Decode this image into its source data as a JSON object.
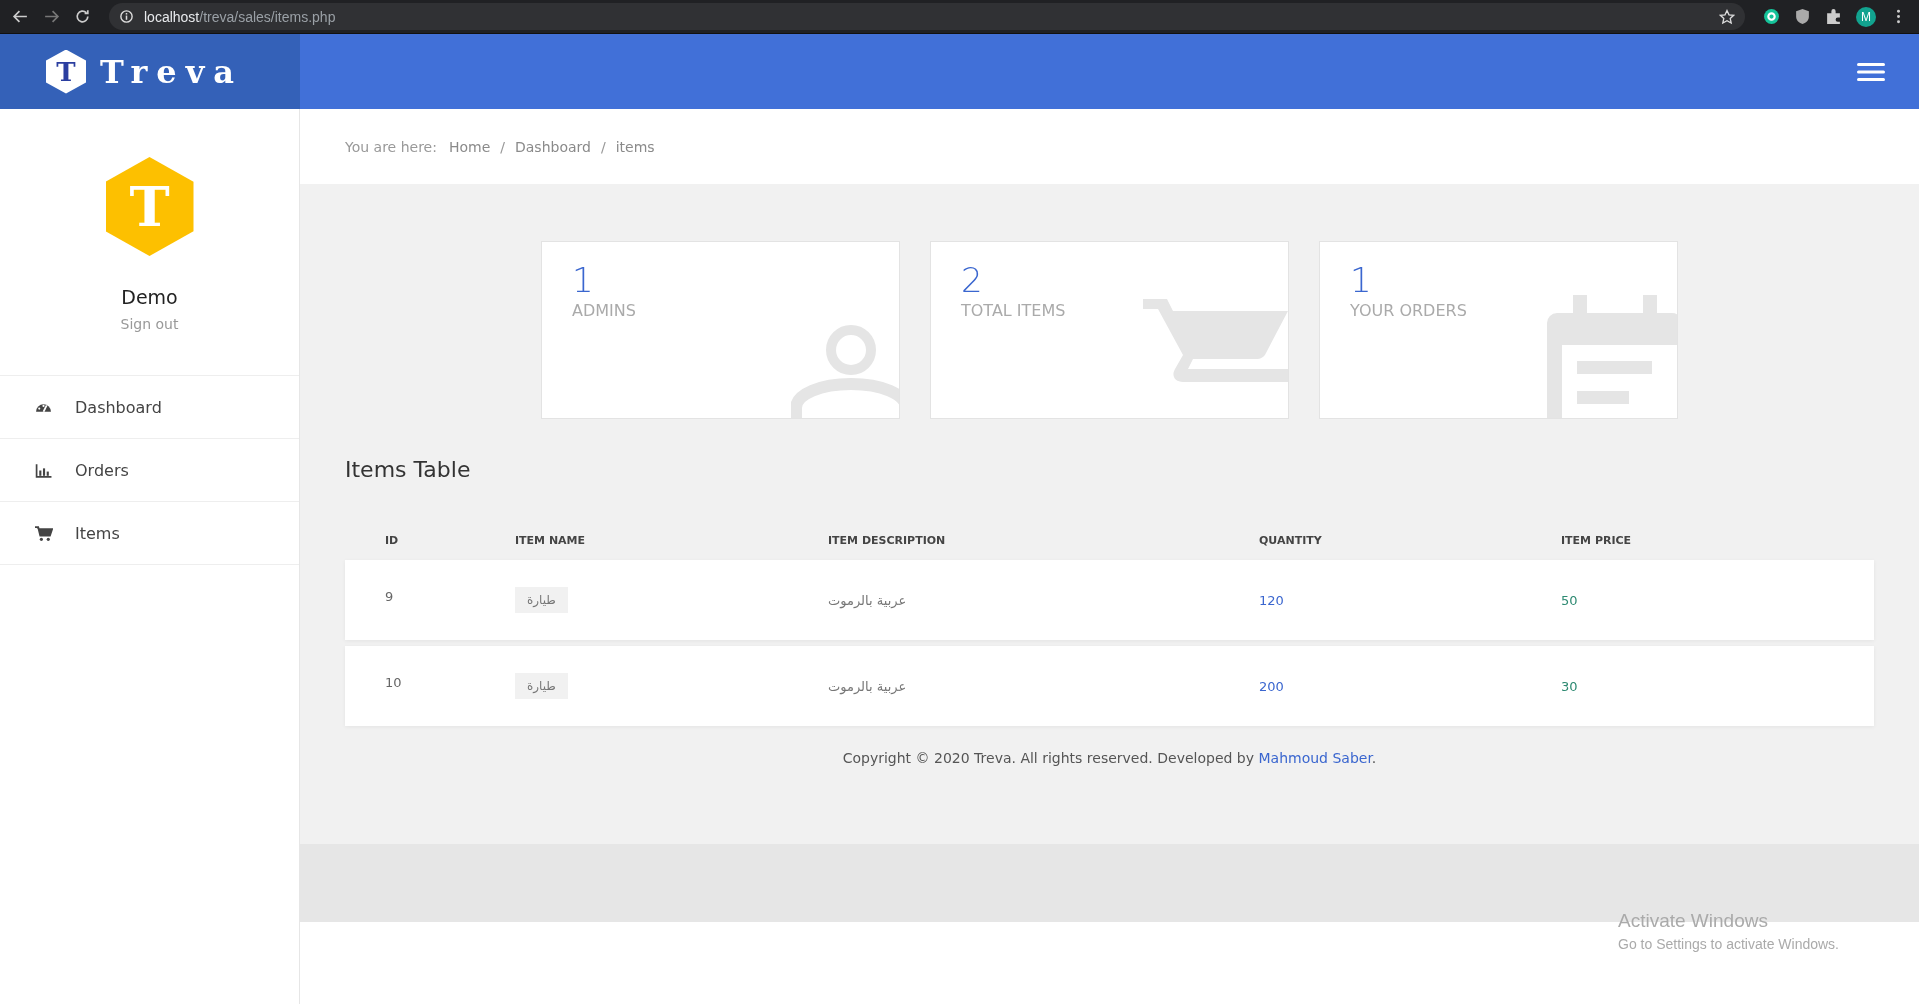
{
  "browser": {
    "url_host": "localhost",
    "url_path": "/treva/sales/items.php",
    "profile_initial": "M"
  },
  "brand": {
    "name": "Treva",
    "logo_letter": "T"
  },
  "user": {
    "avatar_letter": "T",
    "name": "Demo",
    "sign_out": "Sign out"
  },
  "sidebar": {
    "items": [
      {
        "label": "Dashboard",
        "kind": "dashboard"
      },
      {
        "label": "Orders",
        "kind": "orders"
      },
      {
        "label": "Items",
        "kind": "items"
      }
    ]
  },
  "breadcrumb": {
    "prefix": "You are here:",
    "separator": "/",
    "links": [
      "Home",
      "Dashboard",
      "items"
    ]
  },
  "stats": [
    {
      "value": "1",
      "label": "ADMINS",
      "kind": "admins"
    },
    {
      "value": "2",
      "label": "TOTAL ITEMS",
      "kind": "items"
    },
    {
      "value": "1",
      "label": "YOUR ORDERS",
      "kind": "orders"
    }
  ],
  "table": {
    "title": "Items Table",
    "columns": [
      "ID",
      "ITEM NAME",
      "ITEM DESCRIPTION",
      "QUANTITY",
      "ITEM PRICE"
    ],
    "rows": [
      {
        "id": "9",
        "name": "طيارة",
        "description": "عربية بالرموت",
        "quantity": "120",
        "price": "50"
      },
      {
        "id": "10",
        "name": "طيارة",
        "description": "عربية بالرموت",
        "quantity": "200",
        "price": "30"
      }
    ]
  },
  "footer": {
    "text": "Copyright © 2020 Treva. All rights reserved. Developed by",
    "link": "Mahmoud Saber",
    "end": "."
  },
  "os_notice": {
    "title": "Activate Windows",
    "text": "Go to Settings to activate Windows."
  }
}
